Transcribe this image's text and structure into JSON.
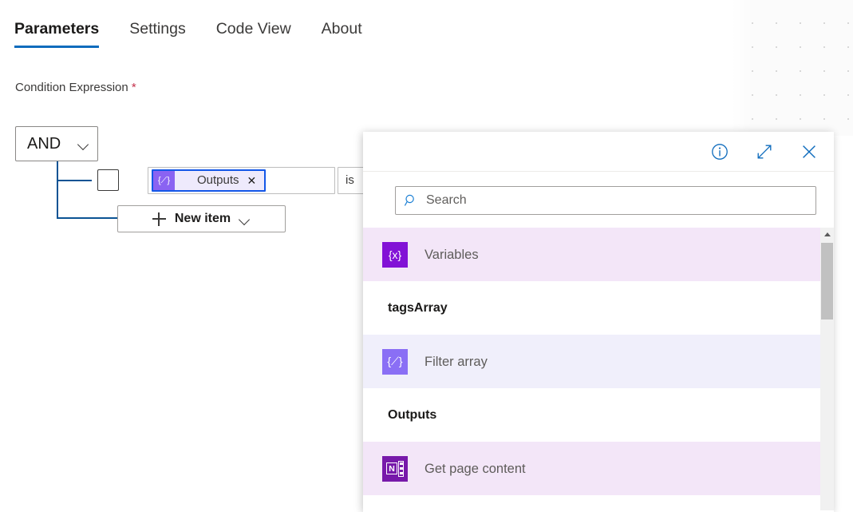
{
  "tabs": [
    {
      "label": "Parameters",
      "active": true
    },
    {
      "label": "Settings",
      "active": false
    },
    {
      "label": "Code View",
      "active": false
    },
    {
      "label": "About",
      "active": false
    }
  ],
  "field": {
    "label": "Condition Expression",
    "required_marker": "*"
  },
  "condition": {
    "logical_operator": "AND",
    "operand_token": {
      "label": "Outputs",
      "icon": "expression-icon",
      "icon_glyph": "{⟋}",
      "remove_glyph": "✕",
      "border_color": "#1357e8",
      "fill_color": "#eeeafc",
      "icon_color": "#8a63f2"
    },
    "operator_value": "is",
    "new_item_label": "New item",
    "connector_color": "#0b5394"
  },
  "panel": {
    "header_buttons": [
      {
        "name": "info-icon",
        "title": "Info"
      },
      {
        "name": "expand-icon",
        "title": "Expand"
      },
      {
        "name": "close-icon",
        "title": "Close"
      }
    ],
    "accent_color": "#0f6cbd",
    "search": {
      "placeholder": "Search",
      "value": "",
      "icon": "search-icon"
    },
    "items": [
      {
        "type": "item",
        "label": "Variables",
        "icon": "variables-icon",
        "icon_glyph": "{x}",
        "icon_color": "#8212d6",
        "row_tint": "#f3e6f8"
      },
      {
        "type": "group",
        "label": "tagsArray"
      },
      {
        "type": "item",
        "label": "Filter array",
        "icon": "expression-icon",
        "icon_glyph": "{⟋}",
        "icon_color": "#8a6ff5",
        "row_tint": "#f0effb"
      },
      {
        "type": "group",
        "label": "Outputs"
      },
      {
        "type": "item",
        "label": "Get page content",
        "icon": "onenote-icon",
        "icon_glyph": "N",
        "icon_color": "#7719aa",
        "row_tint": "#f3e6f8"
      }
    ],
    "scrollbar": {
      "up_arrow": "scroll-up-arrow",
      "thumb_color": "#c1c1c1"
    }
  }
}
